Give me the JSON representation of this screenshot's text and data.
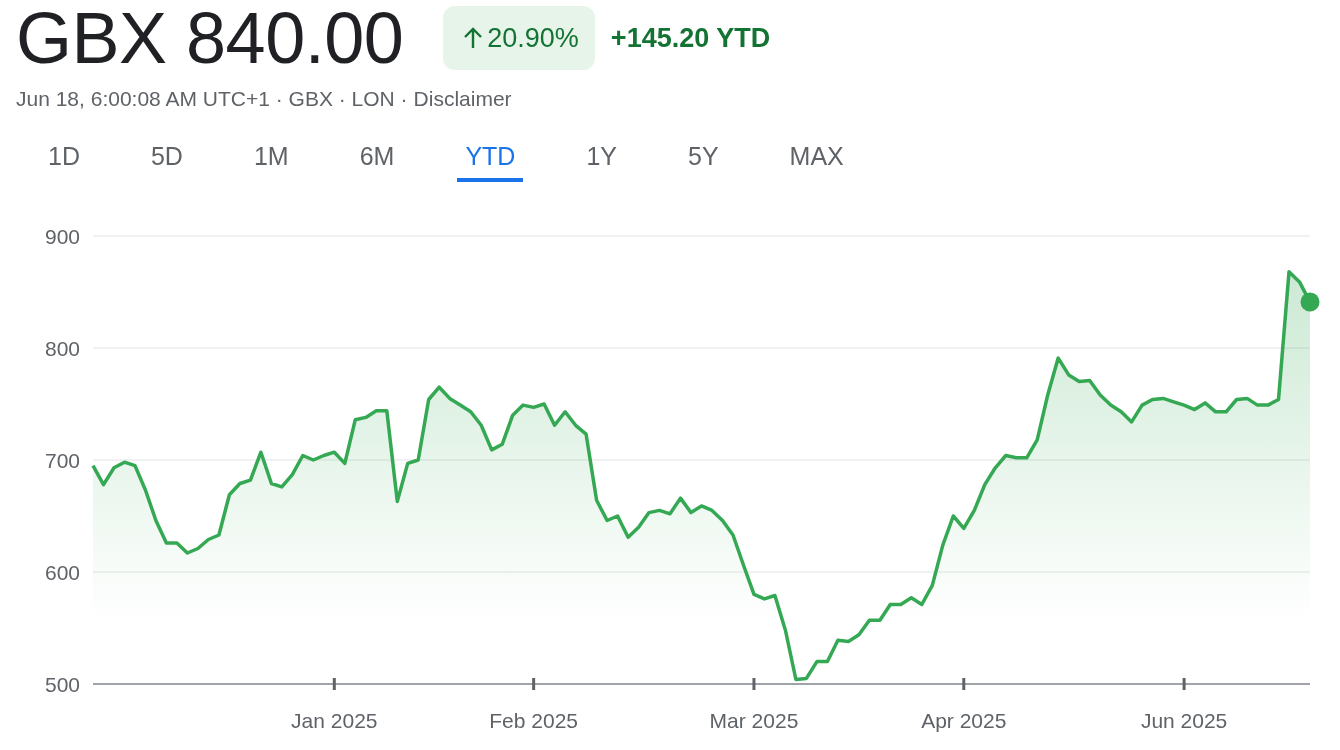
{
  "quote": {
    "price": "GBX 840.00",
    "change": {
      "positive": true,
      "percent": "20.90%"
    },
    "ytd_change": "+145.20 YTD",
    "meta": "Jun 18, 6:00:08 AM UTC+1 · GBX · LON ·",
    "disclaimer": "Disclaimer"
  },
  "ranges": [
    {
      "label": "1D",
      "selected": false
    },
    {
      "label": "5D",
      "selected": false
    },
    {
      "label": "1M",
      "selected": false
    },
    {
      "label": "6M",
      "selected": false
    },
    {
      "label": "YTD",
      "selected": true
    },
    {
      "label": "1Y",
      "selected": false
    },
    {
      "label": "5Y",
      "selected": false
    },
    {
      "label": "MAX",
      "selected": false
    }
  ],
  "chart_data": {
    "type": "area",
    "grid": true,
    "ylim": [
      500,
      900
    ],
    "yticks": [
      500,
      600,
      700,
      800,
      900
    ],
    "categories": [
      null,
      null,
      null,
      null,
      null,
      null,
      null,
      null,
      null,
      null,
      null,
      null,
      null,
      null,
      null,
      null,
      null,
      null,
      null,
      null,
      null,
      null,
      null,
      "Jan 2025",
      null,
      null,
      null,
      null,
      null,
      null,
      null,
      null,
      null,
      null,
      null,
      null,
      null,
      null,
      null,
      null,
      null,
      null,
      "Feb 2025",
      null,
      null,
      null,
      null,
      null,
      null,
      null,
      null,
      null,
      null,
      null,
      null,
      null,
      null,
      null,
      null,
      null,
      null,
      null,
      null,
      "Mar 2025",
      null,
      null,
      null,
      null,
      null,
      null,
      null,
      null,
      null,
      null,
      null,
      null,
      null,
      null,
      null,
      null,
      null,
      null,
      null,
      "Apr 2025",
      null,
      null,
      null,
      null,
      null,
      null,
      null,
      null,
      null,
      null,
      null,
      null,
      null,
      null,
      null,
      null,
      null,
      null,
      null,
      null,
      "Jun 2025",
      null,
      null,
      null,
      null,
      null,
      null,
      null,
      null,
      null,
      null,
      null,
      null
    ],
    "series": [
      {
        "color": "#34a853",
        "values": [
          695,
          678,
          693,
          698,
          695,
          673,
          646,
          626,
          626,
          617,
          621,
          629,
          633,
          669,
          679,
          682,
          707,
          679,
          676,
          687,
          704,
          700,
          704,
          707,
          697,
          736,
          738,
          744,
          744,
          663,
          697,
          700,
          754,
          765,
          755,
          749,
          743,
          731,
          709,
          714,
          740,
          749,
          747,
          750,
          731,
          743,
          731,
          723,
          664,
          646,
          650,
          631,
          640,
          653,
          655,
          652,
          666,
          653,
          659,
          655,
          646,
          633,
          606,
          580,
          576,
          579,
          548,
          504,
          505,
          520,
          520,
          539,
          538,
          544,
          557,
          557,
          571,
          571,
          577,
          571,
          588,
          624,
          650,
          639,
          655,
          678,
          693,
          704,
          702,
          702,
          718,
          758,
          791,
          776,
          770,
          771,
          758,
          749,
          743,
          734,
          749,
          754,
          755,
          752,
          749,
          745,
          751,
          743,
          743,
          754,
          755,
          749,
          749,
          754,
          868,
          859,
          841
        ]
      }
    ]
  }
}
